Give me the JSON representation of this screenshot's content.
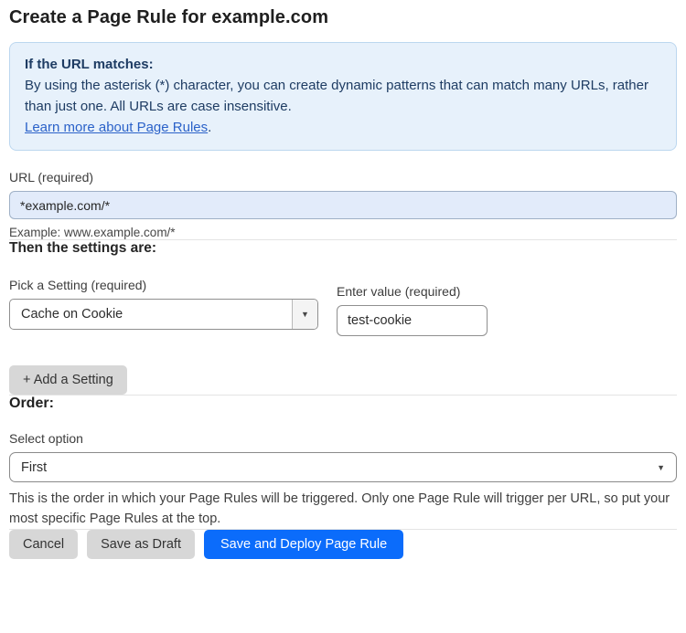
{
  "page": {
    "title": "Create a Page Rule for example.com"
  },
  "info_box": {
    "heading": "If the URL matches:",
    "body": "By using the asterisk (*) character, you can create dynamic patterns that can match many URLs, rather than just one. All URLs are case insensitive.",
    "link_label": "Learn more about Page Rules",
    "link_suffix": "."
  },
  "url_field": {
    "label": "URL (required)",
    "value": "*example.com/*",
    "example": "Example: www.example.com/*"
  },
  "settings": {
    "heading": "Then the settings are:",
    "setting_label": "Pick a Setting (required)",
    "setting_selected": "Cache on Cookie",
    "value_label": "Enter value (required)",
    "value_current": "test-cookie",
    "add_button_label": "+ Add a Setting"
  },
  "order": {
    "heading": "Order:",
    "select_label": "Select option",
    "selected_option": "First",
    "description": "This is the order in which your Page Rules will be triggered. Only one Page Rule will trigger per URL, so put your most specific Page Rules at the top."
  },
  "actions": {
    "cancel_label": "Cancel",
    "save_draft_label": "Save as Draft",
    "save_deploy_label": "Save and Deploy Page Rule"
  },
  "icons": {
    "dropdown_arrow": "▼"
  },
  "colors": {
    "accent_blue": "#0b6cfb",
    "info_box_bg": "#e7f1fb",
    "info_box_border": "#bcd7ef",
    "info_text": "#1e3c63",
    "link_blue": "#2b62c9",
    "url_input_bg": "#e2ebfa",
    "gray_button_bg": "#d7d7d7"
  }
}
